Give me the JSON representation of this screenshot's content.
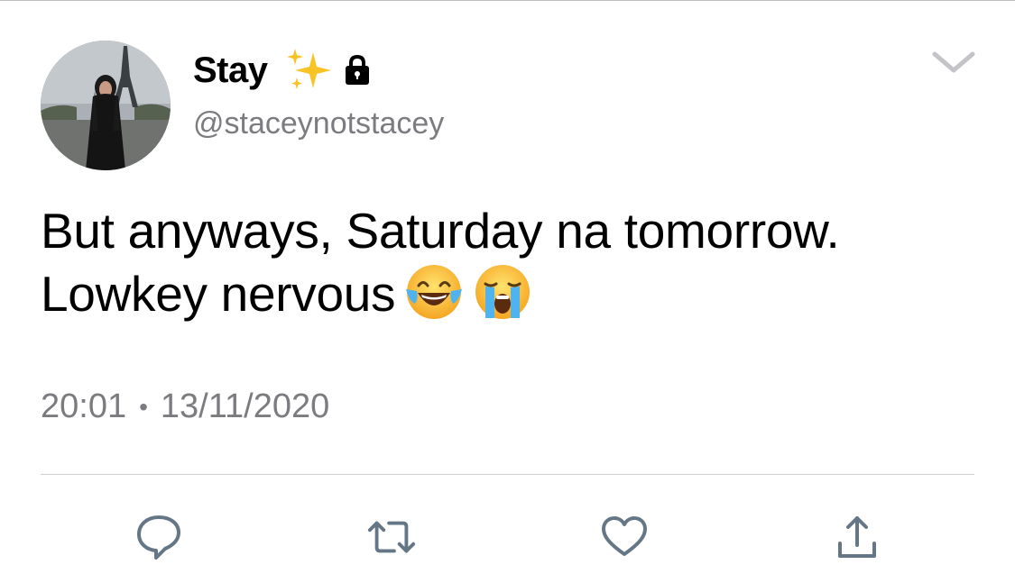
{
  "author": {
    "display_name": "Stay",
    "handle": "@staceynotstacey",
    "name_icons": [
      "sparkles-icon",
      "lock-icon"
    ]
  },
  "tweet": {
    "line1": "But anyways, Saturday na tomorrow.",
    "line2": "Lowkey nervous",
    "emojis": [
      "face-with-tears-of-joy",
      "loudly-crying-face"
    ]
  },
  "meta": {
    "time": "20:01",
    "separator": "•",
    "date": "13/11/2020"
  },
  "actions": [
    "reply-icon",
    "retweet-icon",
    "like-icon",
    "share-icon"
  ],
  "colors": {
    "text": "#000000",
    "secondary": "#7c7c80",
    "icon": "#657786",
    "divider": "#cfcfcf"
  }
}
